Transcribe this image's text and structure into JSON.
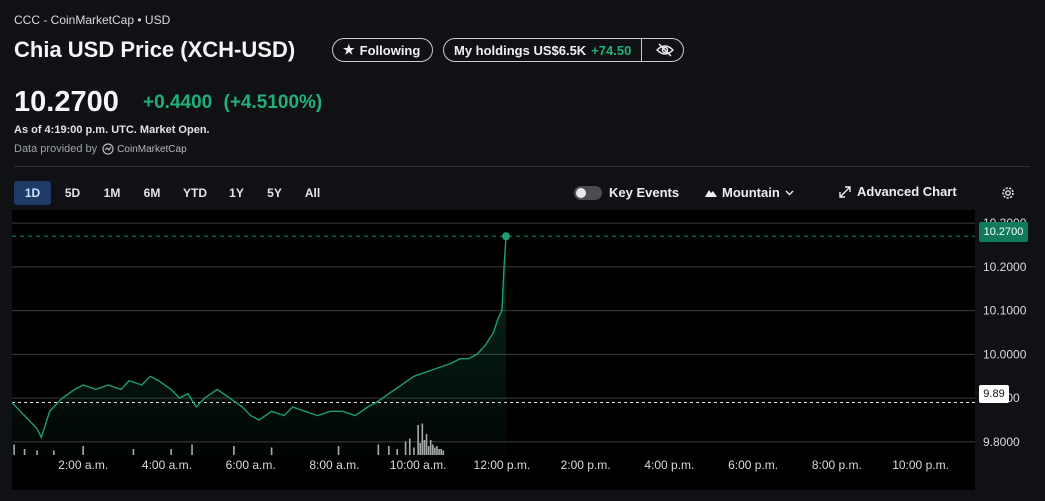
{
  "header": {
    "breadcrumb": "CCC - CoinMarketCap • USD",
    "title": "Chia USD Price (XCH-USD)",
    "following_label": "Following",
    "holdings_label": "My holdings US$6.5K",
    "holdings_change": "+74.50"
  },
  "quote": {
    "price": "10.2700",
    "change": "+0.4400",
    "change_pct": "(+4.5100%)",
    "as_of": "As of 4:19:00 p.m. UTC. Market Open.",
    "provider_prefix": "Data provided by",
    "provider_name": "CoinMarketCap"
  },
  "toolbar": {
    "ranges": [
      "1D",
      "5D",
      "1M",
      "6M",
      "YTD",
      "1Y",
      "5Y",
      "All"
    ],
    "active_range": "1D",
    "key_events_label": "Key Events",
    "chart_style_label": "Mountain",
    "advanced_chart_label": "Advanced Chart"
  },
  "colors": {
    "up": "#21b07a",
    "line": "#1f9d6f",
    "background": "#101114",
    "volume": "#c9cacc"
  },
  "chart_data": {
    "type": "area",
    "x_tick_labels": [
      "2:00 a.m.",
      "4:00 a.m.",
      "6:00 a.m.",
      "8:00 a.m.",
      "10:00 a.m.",
      "12:00 p.m.",
      "2:00 p.m.",
      "4:00 p.m.",
      "6:00 p.m.",
      "8:00 p.m.",
      "10:00 p.m."
    ],
    "x_tick_hours": [
      2,
      4,
      6,
      8,
      10,
      12,
      14,
      16,
      18,
      20,
      22
    ],
    "xlim_hours": [
      0.3,
      23.3
    ],
    "y_tick_labels": [
      "10.3000",
      "10.2000",
      "10.1000",
      "10.0000",
      "9.9000",
      "9.8000"
    ],
    "y_ticks": [
      10.3,
      10.2,
      10.1,
      10.0,
      9.9,
      9.8
    ],
    "ylim": [
      9.77,
      10.33
    ],
    "grid": true,
    "previous_close": 9.89,
    "previous_close_label": "9.89",
    "last_price_label": "10.2700",
    "series": [
      {
        "x": [
          0.3,
          0.5,
          0.7,
          0.9,
          1.0,
          1.2,
          1.5,
          1.8,
          2.0,
          2.3,
          2.6,
          2.9,
          3.1,
          3.4,
          3.6,
          3.8,
          4.1,
          4.3,
          4.5,
          4.7,
          4.9,
          5.2,
          5.5,
          5.8,
          6.0,
          6.2,
          6.5,
          6.8,
          7.0,
          7.3,
          7.6,
          7.9,
          8.2,
          8.5,
          8.8,
          9.0,
          9.3,
          9.6,
          9.9,
          10.2,
          10.5,
          10.8,
          11.0,
          11.2,
          11.4,
          11.6,
          11.8,
          11.9,
          12.0,
          12.05,
          12.1
        ],
        "y": [
          9.89,
          9.87,
          9.85,
          9.83,
          9.81,
          9.87,
          9.9,
          9.92,
          9.93,
          9.92,
          9.93,
          9.92,
          9.94,
          9.93,
          9.95,
          9.94,
          9.92,
          9.9,
          9.91,
          9.88,
          9.9,
          9.92,
          9.9,
          9.88,
          9.86,
          9.85,
          9.87,
          9.86,
          9.88,
          9.87,
          9.86,
          9.87,
          9.87,
          9.86,
          9.88,
          9.89,
          9.91,
          9.93,
          9.95,
          9.96,
          9.97,
          9.98,
          9.99,
          9.99,
          10.0,
          10.02,
          10.05,
          10.08,
          10.1,
          10.2,
          10.27
        ]
      }
    ],
    "volume_x": [
      0.35,
      0.6,
      0.9,
      1.3,
      2.0,
      3.2,
      4.1,
      4.6,
      5.6,
      6.5,
      8.1,
      9.05,
      9.3,
      9.5,
      9.7,
      9.8,
      9.9,
      10.0,
      10.05,
      10.1,
      10.15,
      10.2,
      10.25,
      10.3,
      10.35,
      10.4,
      10.45,
      10.5,
      10.55,
      10.6
    ],
    "volume": [
      0.35,
      0.2,
      0.15,
      0.15,
      0.3,
      0.2,
      0.2,
      0.35,
      0.3,
      0.25,
      0.3,
      0.35,
      0.3,
      0.2,
      0.45,
      0.55,
      0.25,
      1.0,
      0.4,
      1.05,
      0.5,
      0.7,
      0.3,
      0.5,
      0.35,
      0.25,
      0.3,
      0.2,
      0.2,
      0.15
    ]
  }
}
